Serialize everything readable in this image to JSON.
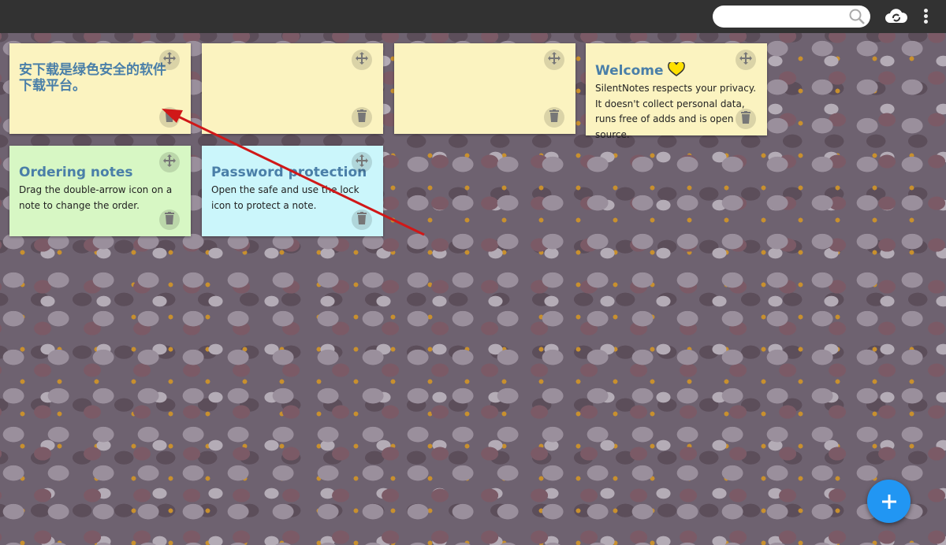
{
  "search": {
    "placeholder": "",
    "value": ""
  },
  "icons": {
    "search": "search-icon",
    "sync": "cloud-sync-icon",
    "menu": "more-vert-icon",
    "move": "move-arrows-icon",
    "delete": "trash-icon",
    "add": "plus-icon",
    "heart": "heart-icon"
  },
  "colors": {
    "yellow": "#fbf3c0",
    "green": "#d7f7c4",
    "cyan": "#cbf6fb",
    "title": "#4a7fa8",
    "fab": "#2196f3",
    "heart": "#ffe000"
  },
  "notes": [
    {
      "title": "安下载是绿色安全的软件下载平台。",
      "body": "",
      "color": "#fbf3c0"
    },
    {
      "title": "",
      "body": "",
      "color": "#fbf3c0"
    },
    {
      "title": "",
      "body": "",
      "color": "#fbf3c0"
    },
    {
      "title": "Welcome",
      "body": "SilentNotes respects your privacy. It doesn't collect personal data, runs free of adds and is open source.",
      "color": "#fbf3c0"
    },
    {
      "title": "Ordering notes",
      "body": "Drag the double-arrow icon on a note to change the order.",
      "color": "#d7f7c4"
    },
    {
      "title": "Password protection",
      "body": "Open the safe and use the lock icon to protect a note.",
      "color": "#cbf6fb"
    }
  ]
}
